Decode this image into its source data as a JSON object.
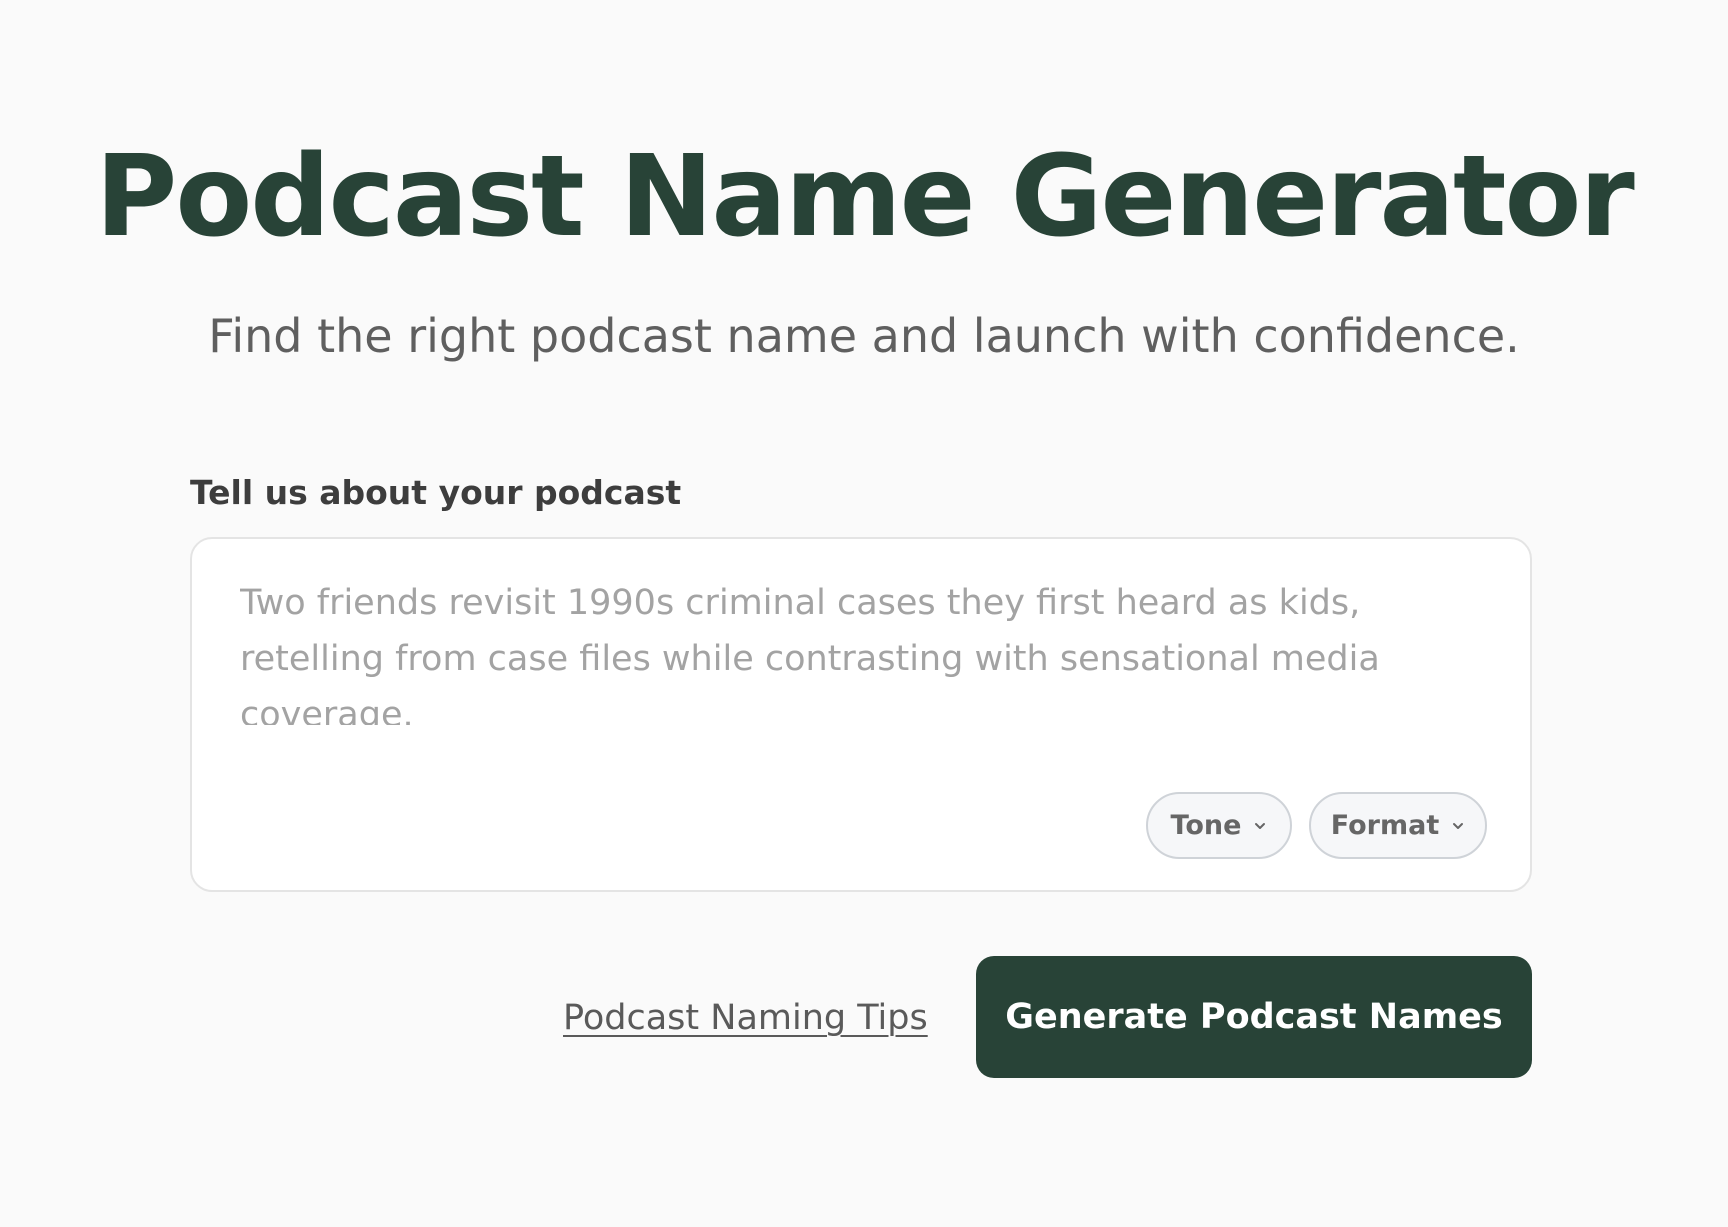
{
  "header": {
    "title": "Podcast Name Generator",
    "subtitle": "Find the right podcast name and launch with confidence."
  },
  "form": {
    "label": "Tell us about your podcast",
    "placeholder": "Two friends revisit 1990s criminal cases they first heard as kids, retelling from case files while contrasting with sensational media coverage.",
    "value": "",
    "pills": [
      {
        "label": "Tone",
        "icon": "chevron-down-icon"
      },
      {
        "label": "Format",
        "icon": "chevron-down-icon"
      }
    ]
  },
  "actions": {
    "tips_link": "Podcast Naming Tips",
    "generate_label": "Generate Podcast Names"
  },
  "colors": {
    "brand": "#284337",
    "background": "#fafafa",
    "muted_text": "#5f5f5f",
    "placeholder": "#a3a3a3"
  }
}
